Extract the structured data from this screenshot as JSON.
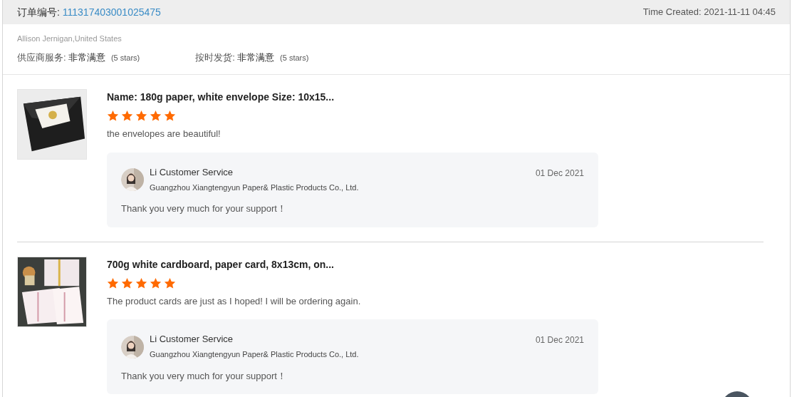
{
  "order": {
    "label": "订单编号:",
    "number": "111317403001025475",
    "time_created": "Time Created: 2021-11-11 04:45"
  },
  "buyer": "Allison Jernigan,United States",
  "ratings": [
    {
      "label": "供应商服务:",
      "value": "非常满意",
      "stars_text": "(5 stars)"
    },
    {
      "label": "按时发货:",
      "value": "非常满意",
      "stars_text": "(5 stars)"
    }
  ],
  "reviews": [
    {
      "kind": "picture",
      "product": "Name: 180g paper, white envelope Size: 10x15...",
      "stars": 5,
      "comment": "the envelopes are beautiful!",
      "reply": {
        "name": "Li Customer Service",
        "company": "Guangzhou Xiangtengyun Paper& Plastic Products Co., Ltd.",
        "date": "01 Dec 2021",
        "text": "Thank you very much for your support！"
      }
    },
    {
      "kind": "picture",
      "product": "700g white cardboard, paper card, 8x13cm, on...",
      "stars": 5,
      "comment": "The product cards are just as I hoped! I will be ordering again.",
      "reply": {
        "name": "Li Customer Service",
        "company": "Guangzhou Xiangtengyun Paper& Plastic Products Co., Ltd.",
        "date": "01 Dec 2021",
        "text": "Thank you very much for your support！"
      }
    }
  ]
}
